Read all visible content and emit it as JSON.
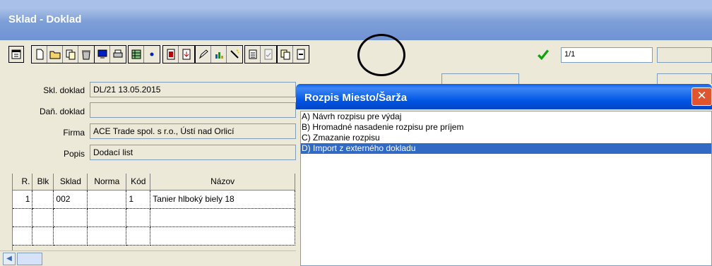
{
  "window": {
    "title": "Sklad - Doklad"
  },
  "toolbar": {
    "buttons": [
      "calendar-icon",
      "new-document-icon",
      "open-folder-icon",
      "copy-icon",
      "recycle-bin-icon",
      "monitor-icon",
      "printer-icon",
      "table-filter-icon",
      "dot-icon",
      "red-document-icon",
      "import-document-icon",
      "edit-icon",
      "chart-icon",
      "wand-icon",
      "calculator-icon",
      "document-check-icon",
      "copy-page-icon",
      "document-minus-icon",
      "check-icon"
    ],
    "page_indicator": "1/1"
  },
  "form": {
    "skl_doklad_label": "Skl. doklad",
    "skl_doklad_value": "DL/21 13.05.2015",
    "dan_doklad_label": "Daň. doklad",
    "dan_doklad_value": "",
    "firma_label": "Firma",
    "firma_value": "ACE Trade spol. s r.o., Ústí nad Orlicí",
    "popis_label": "Popis",
    "popis_value": "Dodací list"
  },
  "grid": {
    "columns": [
      "R.",
      "Blk",
      "Sklad",
      "Norma",
      "Kód",
      "Názov"
    ],
    "rows": [
      [
        "1",
        "",
        "002",
        "",
        "1",
        "Tanier hlboký biely 18"
      ]
    ]
  },
  "dialog": {
    "title": "Rozpis Miesto/Šarža",
    "items": [
      "A) Návrh rozpisu pre výdaj",
      "B) Hromadné nasadenie rozpisu pre príjem",
      "C) Zmazanie rozpisu",
      "D) Import z externého dokladu"
    ],
    "selected_index": 3
  },
  "colors": {
    "title_bar": "#7e9fd8",
    "dialog_title": "#0055e5",
    "selection": "#316ac5",
    "close_button": "#e0552e"
  }
}
